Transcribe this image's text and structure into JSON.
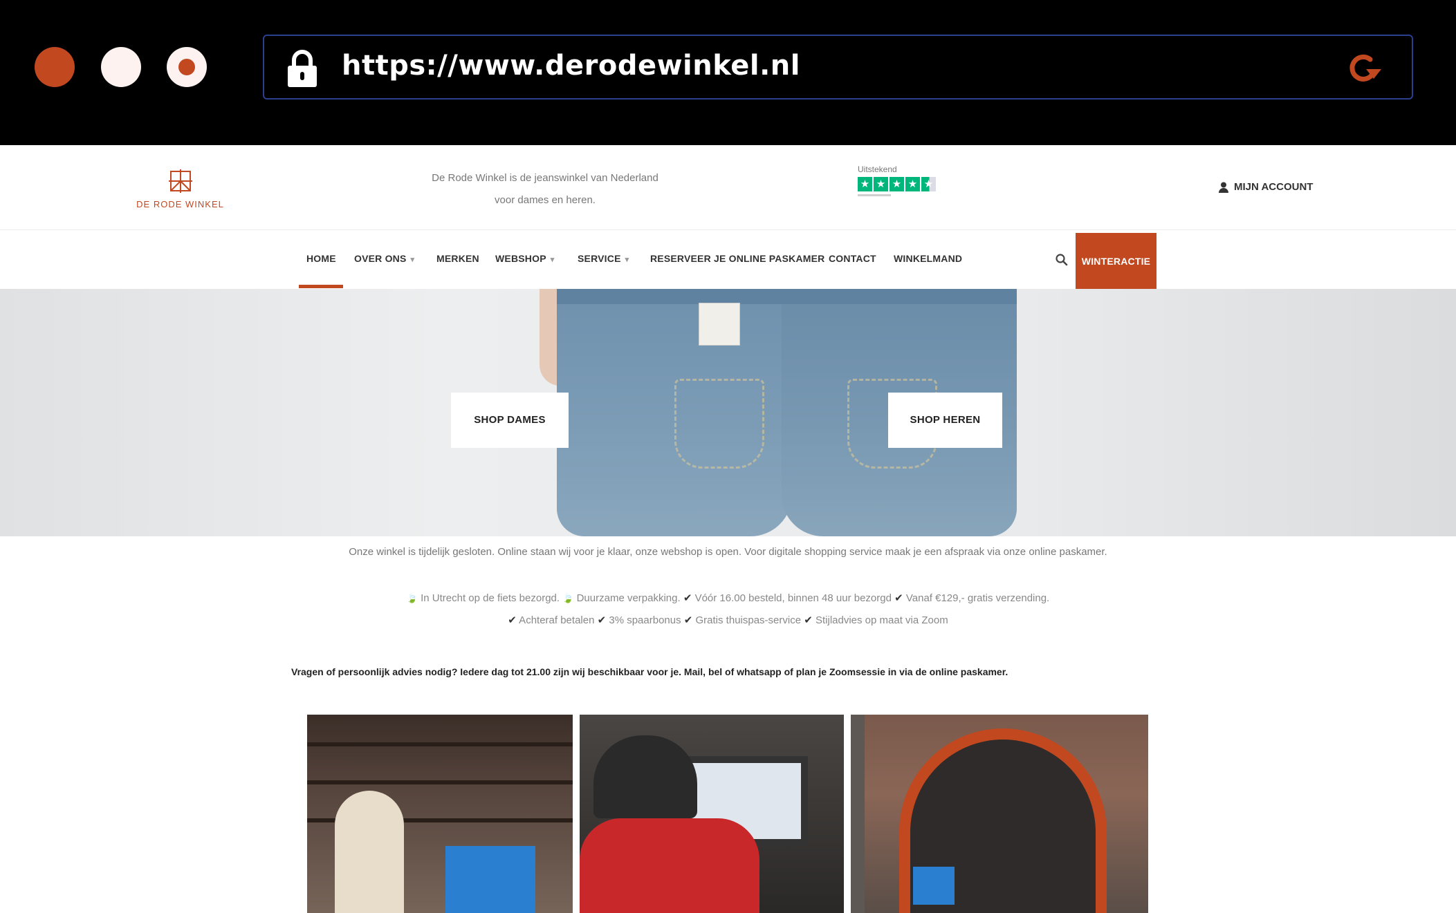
{
  "browser": {
    "url": "https://www.derodewinkel.nl",
    "colors": {
      "accent": "#c2481f",
      "dot_light": "#fdf2f0",
      "url_border": "#2b3f8f"
    }
  },
  "header": {
    "logo_text": "DE RODE WINKEL",
    "tagline_line1": "De Rode Winkel is de jeanswinkel van Nederland",
    "tagline_line2": "voor dames en heren.",
    "trustpilot_label": "Uitstekend",
    "trustpilot_rating": 4.5,
    "account_label": "MIJN ACCOUNT"
  },
  "nav": {
    "items": [
      {
        "label": "HOME",
        "active": true
      },
      {
        "label": "OVER ONS",
        "has_dropdown": true
      },
      {
        "label": "MERKEN"
      },
      {
        "label": "WEBSHOP",
        "has_dropdown": true
      },
      {
        "label": "SERVICE",
        "has_dropdown": true
      },
      {
        "label": "RESERVEER JE ONLINE PASKAMER"
      },
      {
        "label": "CONTACT"
      },
      {
        "label": "WINKELMAND"
      }
    ],
    "cta_label": "WINTERACTIE"
  },
  "hero": {
    "shop_dames": "SHOP DAMES",
    "shop_heren": "SHOP HEREN"
  },
  "notice": "Onze winkel is tijdelijk gesloten. Online staan wij voor je klaar, onze webshop is open. Voor digitale shopping service maak je een afspraak via onze online paskamer.",
  "usps": {
    "line1": [
      {
        "icon": "leaf-icon",
        "text": " In Utrecht op de fiets bezorgd."
      },
      {
        "icon": "leaf-icon",
        "text": " Duurzame verpakking."
      },
      {
        "icon": "check-icon",
        "text": " Vóór 16.00 besteld, binnen 48 uur bezorgd"
      },
      {
        "icon": "check-icon",
        "text": " Vanaf €129,- gratis verzending."
      }
    ],
    "line2": [
      {
        "icon": "check-icon",
        "text": " Achteraf betalen"
      },
      {
        "icon": "check-icon",
        "text": " 3% spaarbonus"
      },
      {
        "icon": "check-icon",
        "text": " Gratis thuispas-service"
      },
      {
        "icon": "check-icon",
        "text": " Stijladvies op maat via Zoom"
      }
    ]
  },
  "advice": "Vragen of persoonlijk advies nodig? Iedere dag tot 21.00 zijn wij beschikbaar voor je. Mail, bel of whatsapp of plan je Zoomsessie in via de online paskamer."
}
